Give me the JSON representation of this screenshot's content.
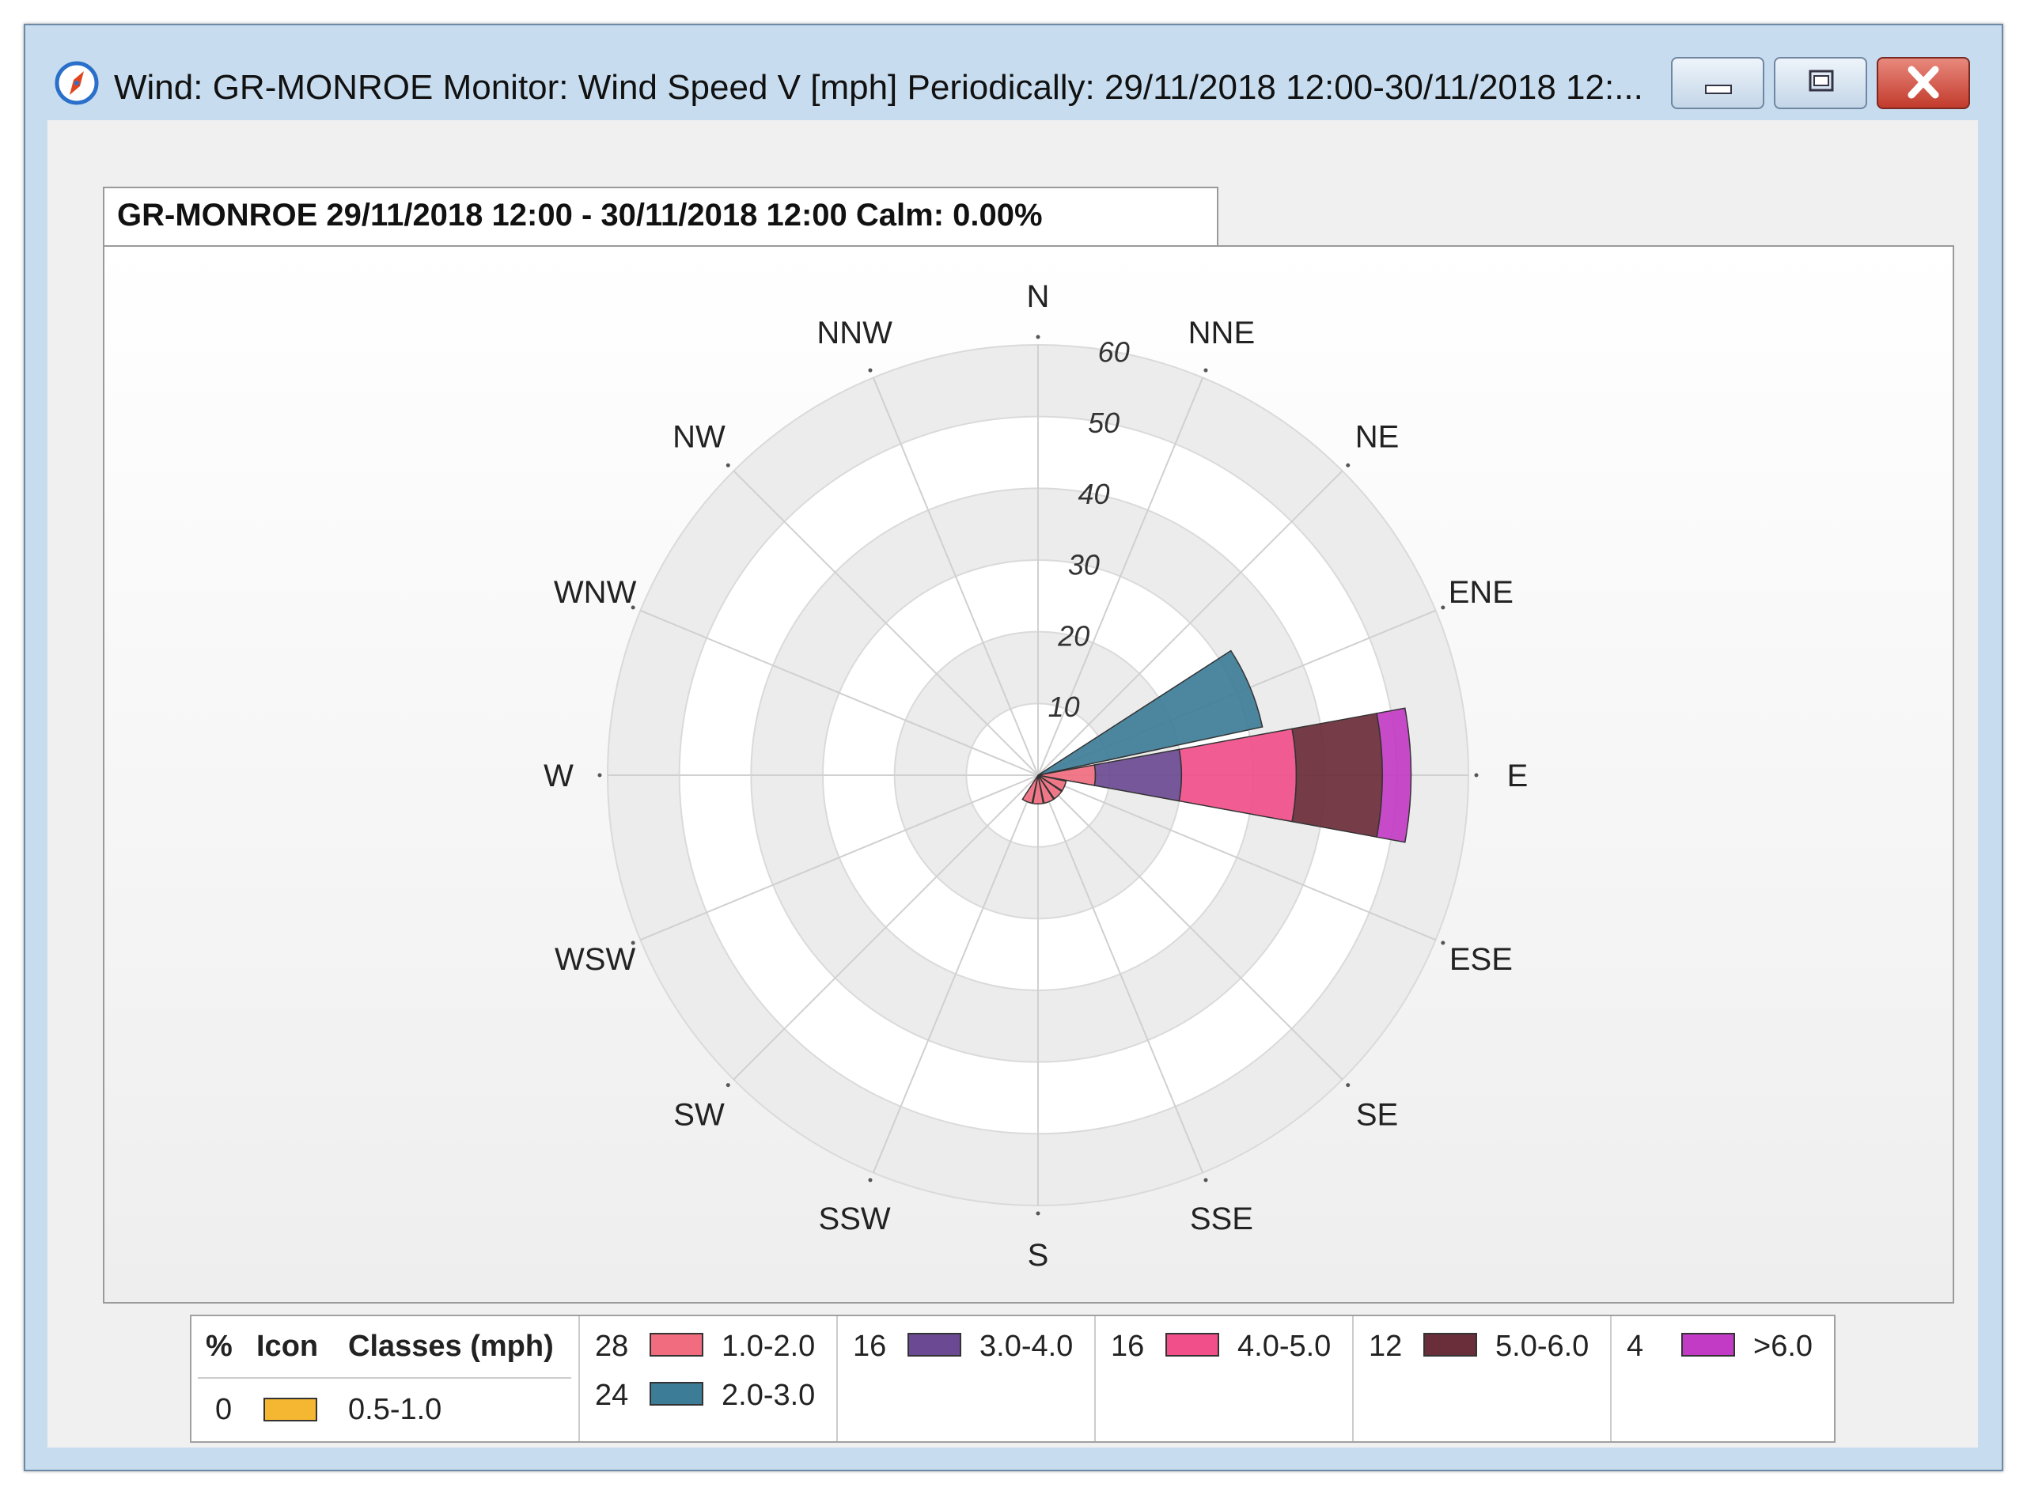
{
  "window": {
    "title": "Wind: GR-MONROE  Monitor: Wind Speed V [mph]  Periodically: 29/11/2018 12:00-30/11/2018 12:...",
    "icon": "compass-icon",
    "buttons": {
      "minimize": "minimize-icon",
      "maximize": "maximize-icon",
      "close": "close-icon"
    }
  },
  "group_title": "GR-MONROE 29/11/2018 12:00 - 30/11/2018 12:00 Calm: 0.00%",
  "chart_data": {
    "type": "wind-rose",
    "directions": [
      "N",
      "NNE",
      "NE",
      "ENE",
      "E",
      "ESE",
      "SE",
      "SSE",
      "S",
      "SSW",
      "SW",
      "WSW",
      "W",
      "WNW",
      "NW",
      "NNW"
    ],
    "radial_ticks": [
      10,
      20,
      30,
      40,
      50,
      60
    ],
    "rlim": [
      0,
      60
    ],
    "grid": true,
    "classes": [
      {
        "name": "0.5-1.0",
        "percent": "0",
        "color": "#f5b731"
      },
      {
        "name": "1.0-2.0",
        "percent": "28",
        "color": "#f06c7e"
      },
      {
        "name": "2.0-3.0",
        "percent": "24",
        "color": "#3d7c97"
      },
      {
        "name": "3.0-4.0",
        "percent": "16",
        "color": "#6b4a93"
      },
      {
        "name": "4.0-5.0",
        "percent": "16",
        "color": "#f04f8a"
      },
      {
        "name": "5.0-6.0",
        "percent": "12",
        "color": "#6a2d3a"
      },
      {
        "name": ">6.0",
        "percent": "4",
        "color": "#c23bc4"
      }
    ],
    "petals": [
      {
        "direction": "ENE",
        "segments": [
          {
            "class": "2.0-3.0",
            "from": 0,
            "to": 32
          }
        ]
      },
      {
        "direction": "E",
        "segments": [
          {
            "class": "1.0-2.0",
            "from": 0,
            "to": 8
          },
          {
            "class": "3.0-4.0",
            "from": 8,
            "to": 20
          },
          {
            "class": "4.0-5.0",
            "from": 20,
            "to": 36
          },
          {
            "class": "5.0-6.0",
            "from": 36,
            "to": 48
          },
          {
            "class": ">6.0",
            "from": 48,
            "to": 52
          }
        ]
      },
      {
        "direction": "SE",
        "segments": [
          {
            "class": "1.0-2.0",
            "from": 0,
            "to": 4
          }
        ]
      },
      {
        "direction": "SSE",
        "segments": [
          {
            "class": "1.0-2.0",
            "from": 0,
            "to": 4
          }
        ]
      },
      {
        "direction": "S",
        "segments": [
          {
            "class": "1.0-2.0",
            "from": 0,
            "to": 4
          }
        ]
      },
      {
        "direction": "SSW",
        "segments": [
          {
            "class": "1.0-2.0",
            "from": 0,
            "to": 4
          }
        ]
      },
      {
        "direction": "ESE",
        "segments": [
          {
            "class": "1.0-2.0",
            "from": 0,
            "to": 4
          }
        ]
      }
    ]
  },
  "legend": {
    "headers": {
      "percent": "%",
      "icon": "Icon",
      "classes": "Classes (mph)"
    }
  }
}
